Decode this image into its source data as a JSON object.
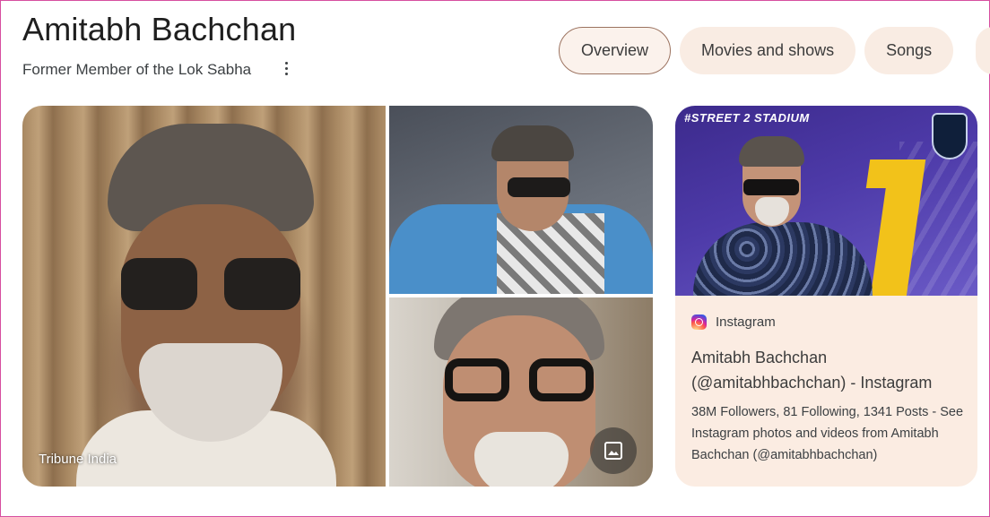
{
  "header": {
    "title": "Amitabh Bachchan",
    "subtitle": "Former Member of the Lok Sabha"
  },
  "tabs": [
    {
      "label": "Overview",
      "active": true
    },
    {
      "label": "Movies and shows",
      "active": false
    },
    {
      "label": "Songs",
      "active": false
    }
  ],
  "images": {
    "main_caption": "Tribune India"
  },
  "card": {
    "image_banner": "#STREET 2 STADIUM",
    "source": "Instagram",
    "title": "Amitabh Bachchan (@amitabhbachchan) - Instagram",
    "description": "38M Followers, 81 Following, 1341 Posts - See Instagram photos and videos from Amitabh Bachchan (@amitabhbachchan)"
  },
  "colors": {
    "tab_bg": "#f9ece3",
    "tab_active_border": "#9c7360",
    "card_bg": "#fbece2"
  },
  "icons": [
    "more-vert-icon",
    "instagram-icon",
    "image-gallery-icon"
  ]
}
